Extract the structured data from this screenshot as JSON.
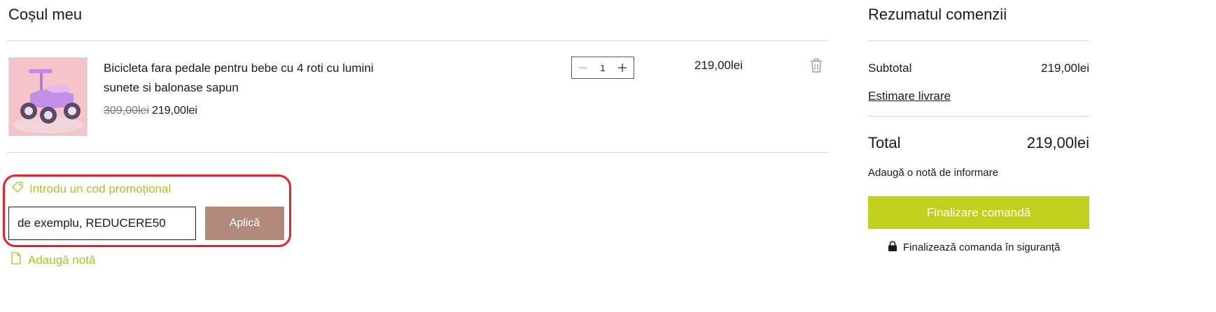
{
  "cart": {
    "title": "Coșul meu",
    "item": {
      "name": "Bicicleta fara pedale pentru bebe cu 4 roti cu lumini sunete si balonase sapun",
      "old_price": "309,00lei",
      "price": "219,00lei",
      "quantity": "1",
      "line_total": "219,00lei"
    },
    "promo": {
      "link_label": "Introdu un cod promoțional",
      "placeholder": "de exemplu, REDUCERE50",
      "apply_label": "Aplică"
    },
    "note_label": "Adaugă notă"
  },
  "summary": {
    "title": "Rezumatul comenzii",
    "subtotal_label": "Subtotal",
    "subtotal_value": "219,00lei",
    "estimate_label": "Estimare livrare",
    "total_label": "Total",
    "total_value": "219,00lei",
    "add_note_label": "Adaugă o notă de informare",
    "checkout_label": "Finalizare comandă",
    "secure_label": "Finalizează comanda în siguranță"
  },
  "colors": {
    "accent_green": "#c0d01c",
    "link_green": "#a9c520",
    "apply_brown": "#b0897a",
    "highlight_red": "#e8202b"
  },
  "icons": [
    "tag-icon",
    "file-icon",
    "lock-icon",
    "trash-icon",
    "minus-icon",
    "plus-icon"
  ]
}
